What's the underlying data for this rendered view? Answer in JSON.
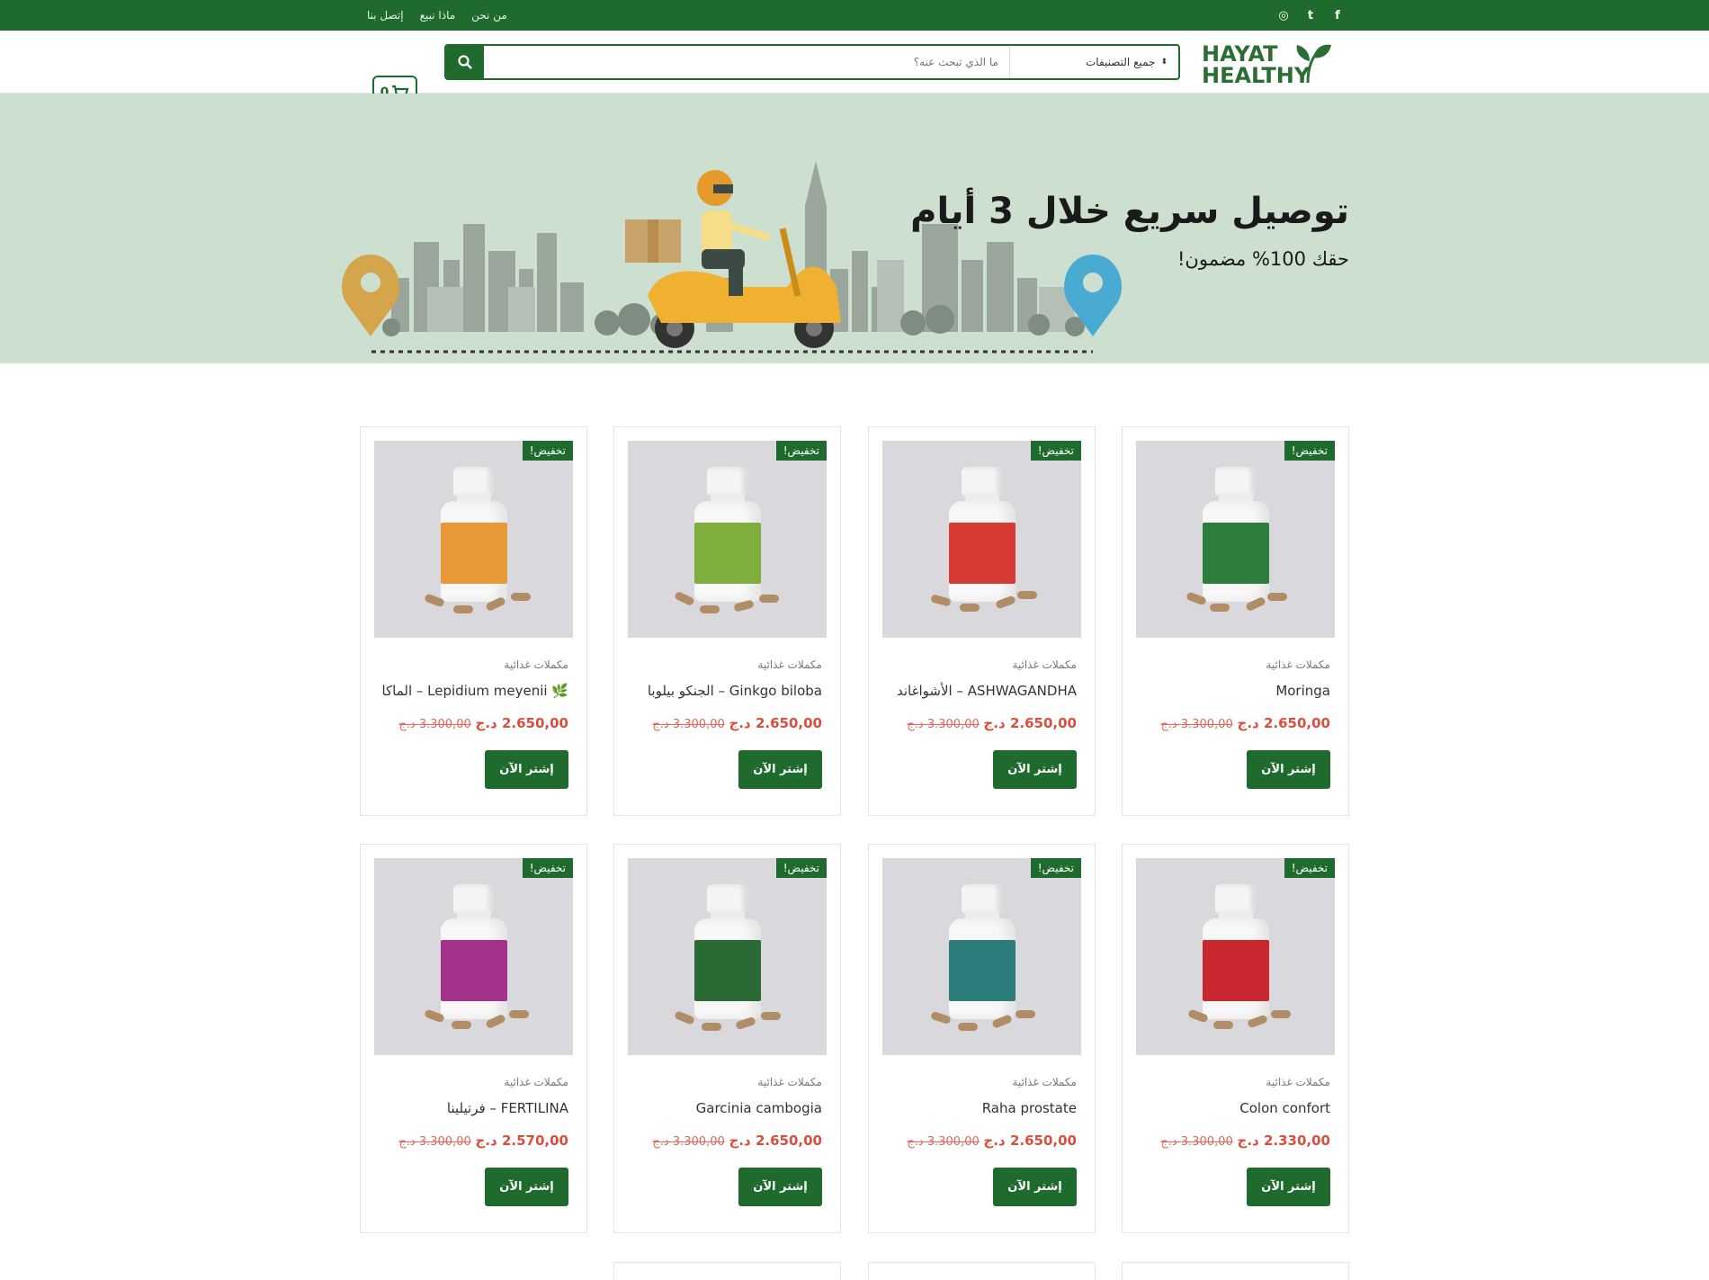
{
  "topbar": {
    "links": [
      "من نحن",
      "ماذا نبيع",
      "إتصل بنا"
    ],
    "social": [
      {
        "icon": "facebook-icon",
        "glyph": "f"
      },
      {
        "icon": "twitter-icon",
        "glyph": "t"
      },
      {
        "icon": "instagram-icon",
        "glyph": "◎"
      }
    ]
  },
  "header": {
    "logo_line1": "HAYAT",
    "logo_line2": "HEALTHY",
    "search_placeholder": "ما الذي تبحث عنه؟",
    "category_select": "جميع التصنيفات",
    "cart_count": "0"
  },
  "hero": {
    "title": "توصيل سريع خلال 3 أيام",
    "subtitle": "حقك 100% مضمون!"
  },
  "products": [
    {
      "name": "Moringa",
      "category": "مكملات غذائية",
      "old_price": "3.300,00 د.ج",
      "new_price": "2.650,00 د.ج",
      "badge": "تخفيض!",
      "cta": "إشتر الآن",
      "label_color": "#2f7d3d"
    },
    {
      "name": "ASHWAGANDHA – الأشواغاند",
      "category": "مكملات غذائية",
      "old_price": "3.300,00 د.ج",
      "new_price": "2.650,00 د.ج",
      "badge": "تخفيض!",
      "cta": "إشتر الآن",
      "label_color": "#d63a32"
    },
    {
      "name": "Ginkgo biloba – الجنكو بيلوبا",
      "category": "مكملات غذائية",
      "old_price": "3.300,00 د.ج",
      "new_price": "2.650,00 د.ج",
      "badge": "تخفيض!",
      "cta": "إشتر الآن",
      "label_color": "#7fae3c"
    },
    {
      "name": "🌿 Lepidium meyenii – الماكا",
      "category": "مكملات غذائية",
      "old_price": "3.300,00 د.ج",
      "new_price": "2.650,00 د.ج",
      "badge": "تخفيض!",
      "cta": "إشتر الآن",
      "label_color": "#e89a3a"
    },
    {
      "name": "Colon confort",
      "category": "مكملات غذائية",
      "old_price": "3.300,00 د.ج",
      "new_price": "2.330,00 د.ج",
      "badge": "تخفيض!",
      "cta": "إشتر الآن",
      "label_color": "#c8282e"
    },
    {
      "name": "Raha prostate",
      "category": "مكملات غذائية",
      "old_price": "3.300,00 د.ج",
      "new_price": "2.650,00 د.ج",
      "badge": "تخفيض!",
      "cta": "إشتر الآن",
      "label_color": "#2c7d7a"
    },
    {
      "name": "Garcinia cambogia",
      "category": "مكملات غذائية",
      "old_price": "3.300,00 د.ج",
      "new_price": "2.650,00 د.ج",
      "badge": "تخفيض!",
      "cta": "إشتر الآن",
      "label_color": "#2a6b35"
    },
    {
      "name": "FERTILINA – فرتيلينا",
      "category": "مكملات غذائية",
      "old_price": "3.300,00 د.ج",
      "new_price": "2.570,00 د.ج",
      "badge": "تخفيض!",
      "cta": "إشتر الآن",
      "label_color": "#a3338a"
    }
  ],
  "colors": {
    "brand_green": "#1f6b2e",
    "sale_red": "#d94f3d",
    "hero_bg": "#cddfce"
  }
}
